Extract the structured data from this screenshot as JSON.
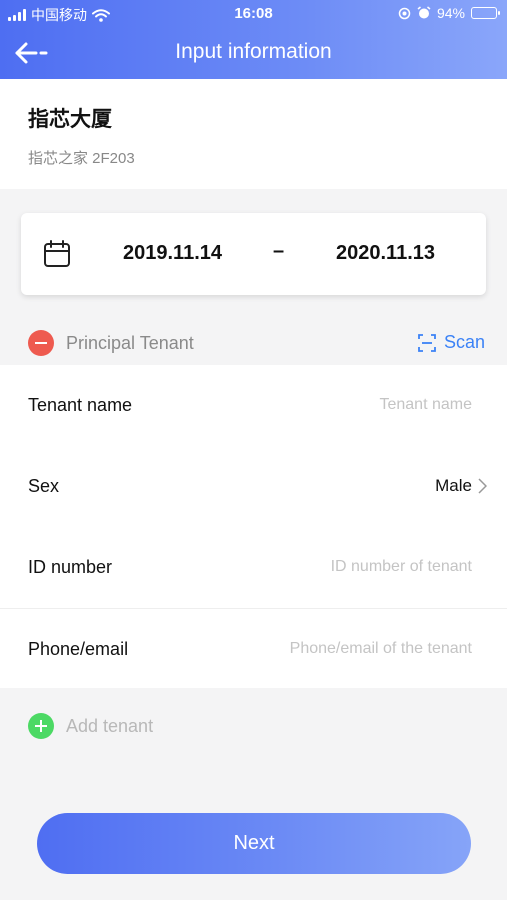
{
  "status_bar": {
    "carrier": "中国移动",
    "time": "16:08",
    "battery": "94%",
    "battery_level": 0.94
  },
  "nav": {
    "title": "Input information",
    "back_icon": "back-arrow-icon"
  },
  "building": {
    "name": "指芯大厦",
    "address": "指芯之家 2F203"
  },
  "lease": {
    "start_date": "2019.11.14",
    "separator": "–",
    "end_date": "2020.11.13"
  },
  "principal": {
    "label": "Principal Tenant",
    "scan_label": "Scan"
  },
  "form": {
    "tenant_name": {
      "label": "Tenant name",
      "placeholder": "Tenant name",
      "value": ""
    },
    "sex": {
      "label": "Sex",
      "value": "Male"
    },
    "id_number": {
      "label": "ID number",
      "placeholder": "ID number of tenant",
      "value": ""
    },
    "phone_email": {
      "label": "Phone/email",
      "placeholder": "Phone/email of the tenant",
      "value": ""
    }
  },
  "add_tenant": {
    "label": "Add tenant"
  },
  "next_button": {
    "label": "Next"
  },
  "colors": {
    "accent": "#4e6ef2",
    "scan_blue": "#3b82f6",
    "remove_red": "#ee5a4f",
    "add_green": "#4cd964"
  }
}
